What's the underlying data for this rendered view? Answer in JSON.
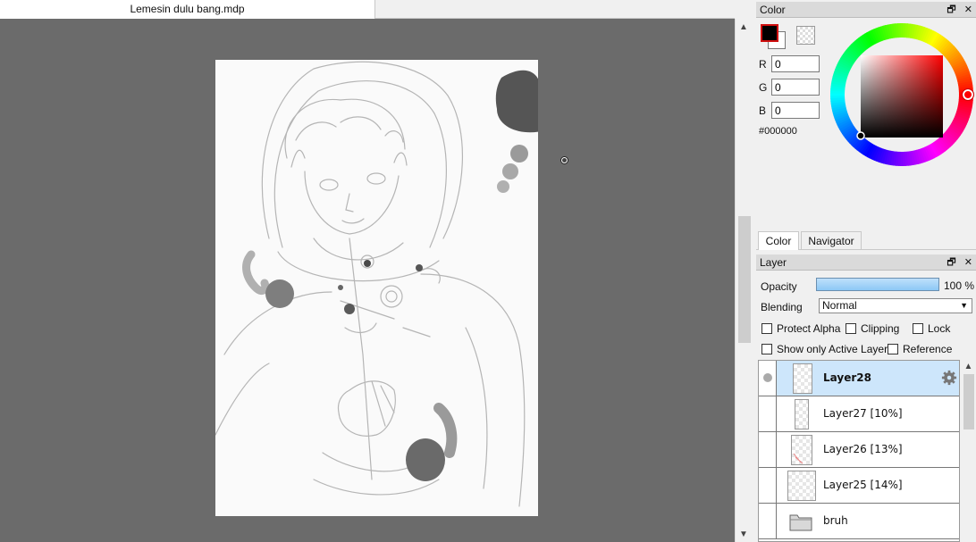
{
  "document": {
    "tab_title": "Lemesin dulu bang.mdp"
  },
  "color_panel": {
    "title": "Color",
    "r_label": "R",
    "g_label": "G",
    "b_label": "B",
    "r": "0",
    "g": "0",
    "b": "0",
    "hex": "#000000",
    "foreground": "#000000",
    "background": "#ffffff"
  },
  "panel_tabs": [
    {
      "label": "Color",
      "active": true
    },
    {
      "label": "Navigator",
      "active": false
    }
  ],
  "layer_panel": {
    "title": "Layer",
    "opacity_label": "Opacity",
    "opacity_value": "100 %",
    "opacity_fraction": 1.0,
    "blending_label": "Blending",
    "blending_value": "Normal",
    "checkboxes": {
      "protect_alpha": "Protect Alpha",
      "clipping": "Clipping",
      "lock": "Lock",
      "show_only_active": "Show only Active Layer",
      "reference": "Reference"
    },
    "layers": [
      {
        "name": "Layer28",
        "selected": true,
        "visible_dot": true,
        "icon": "gear-icon"
      },
      {
        "name": "Layer27 [10%]",
        "selected": false
      },
      {
        "name": "Layer26 [13%]",
        "selected": false
      },
      {
        "name": "Layer25 [14%]",
        "selected": false
      },
      {
        "name": "bruh",
        "selected": false,
        "icon": "folder-icon"
      }
    ]
  },
  "colors": {
    "canvas_bg": "#6b6b6b",
    "selection": "#cde6fb",
    "accent_red": "#d01010"
  }
}
